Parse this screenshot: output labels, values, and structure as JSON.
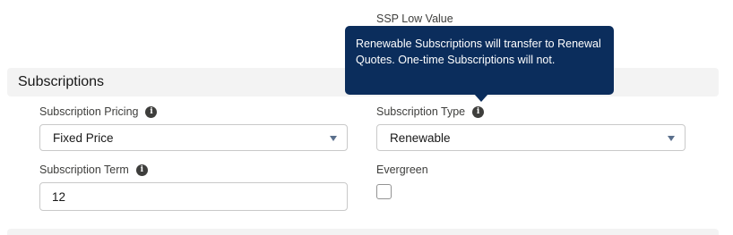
{
  "top_field": {
    "label": "SSP Low Value"
  },
  "section": {
    "title": "Subscriptions"
  },
  "tooltip": {
    "text": "Renewable Subscriptions will transfer to Renewal Quotes. One-time Subscriptions will not."
  },
  "fields": {
    "subscription_pricing": {
      "label": "Subscription Pricing",
      "value": "Fixed Price",
      "icon": "info-icon"
    },
    "subscription_type": {
      "label": "Subscription Type",
      "value": "Renewable",
      "icon": "info-icon"
    },
    "subscription_term": {
      "label": "Subscription Term",
      "value": "12",
      "icon": "info-icon"
    },
    "evergreen": {
      "label": "Evergreen",
      "checked": false
    }
  },
  "colors": {
    "tooltip_bg": "#0b2d5c",
    "section_bg": "#f3f3f3",
    "border": "#c9c9c9"
  }
}
